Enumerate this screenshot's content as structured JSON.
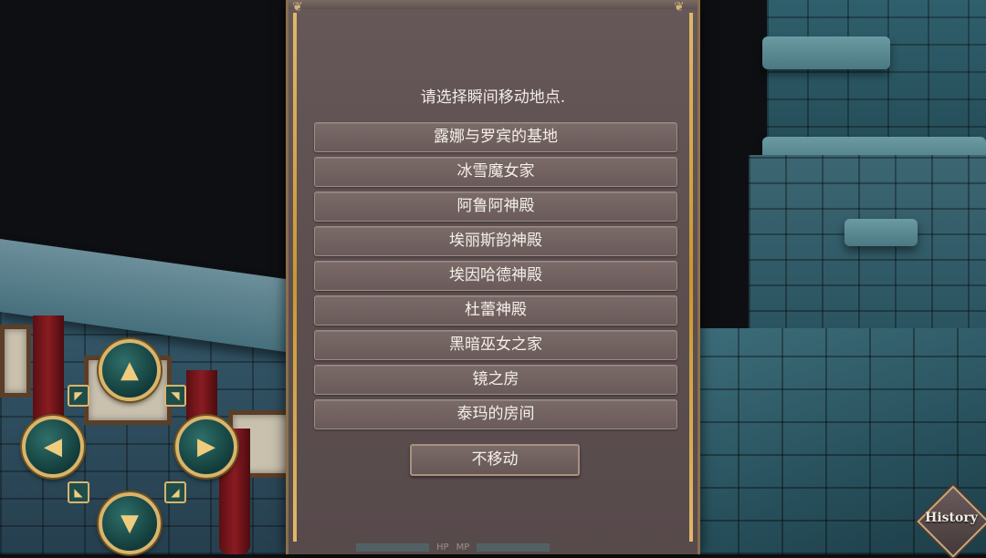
{
  "dialog": {
    "prompt": "请选择瞬间移动地点.",
    "options": [
      "露娜与罗宾的基地",
      "冰雪魔女家",
      "阿鲁阿神殿",
      "埃丽斯韵神殿",
      "埃因哈德神殿",
      "杜蕾神殿",
      "黑暗巫女之家",
      "镜之房",
      "泰玛的房间"
    ],
    "cancel_label": "不移动"
  },
  "status": {
    "hp_label": "HP",
    "mp_label": "MP"
  },
  "history_button": {
    "label": "History"
  },
  "icons": {
    "dpad_up": "dpad-up-icon",
    "dpad_down": "dpad-down-icon",
    "dpad_left": "dpad-left-icon",
    "dpad_right": "dpad-right-icon"
  },
  "colors": {
    "dialog_bg": "#5d4f50",
    "gold_trim": "#d9b56c",
    "option_bg": "#6a5b5a",
    "text": "#f4efe9"
  }
}
